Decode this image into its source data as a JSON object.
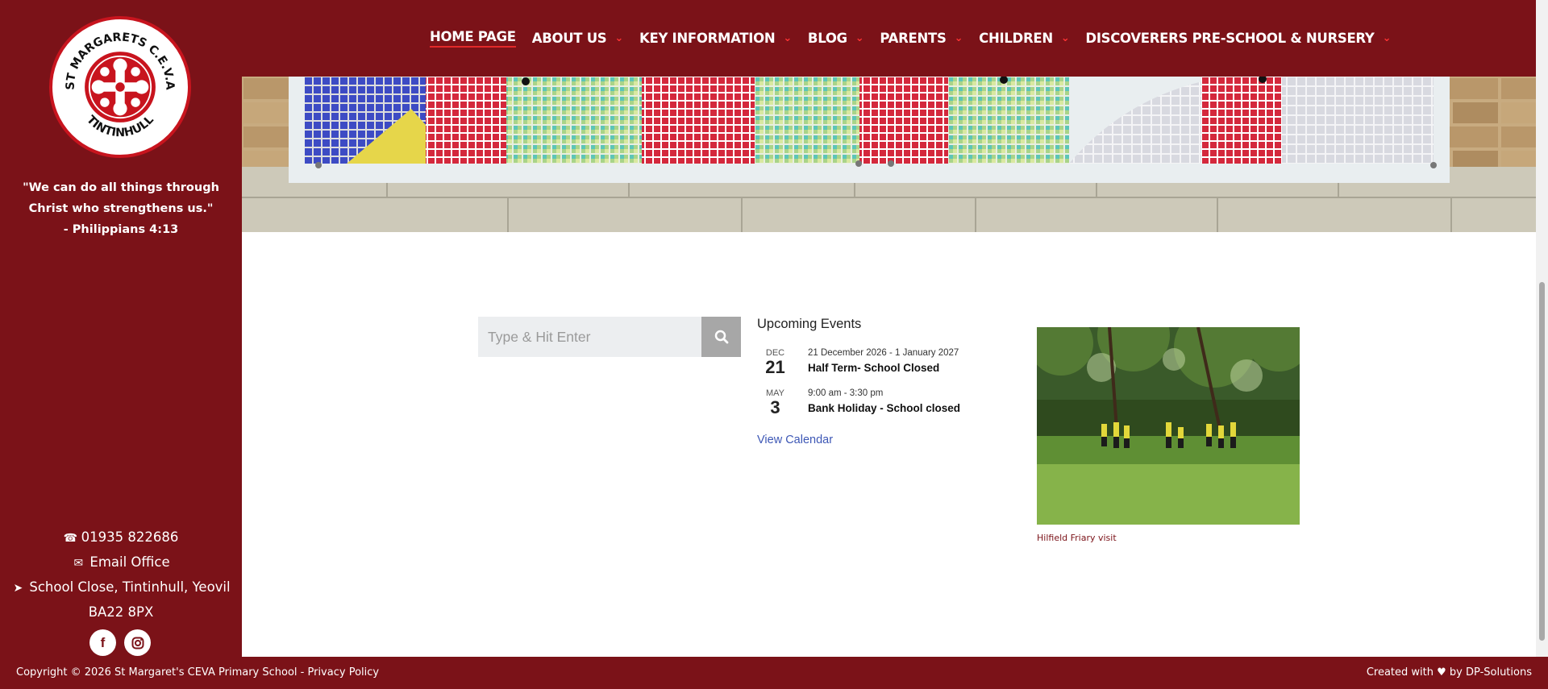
{
  "nav": {
    "items": [
      {
        "label": "HOME PAGE",
        "has_dropdown": false,
        "active": true
      },
      {
        "label": "ABOUT US",
        "has_dropdown": true
      },
      {
        "label": "KEY INFORMATION",
        "has_dropdown": true
      },
      {
        "label": "BLOG",
        "has_dropdown": true
      },
      {
        "label": "PARENTS",
        "has_dropdown": true
      },
      {
        "label": "CHILDREN",
        "has_dropdown": true
      },
      {
        "label": "DISCOVERERS PRE-SCHOOL & NURSERY",
        "has_dropdown": true
      }
    ]
  },
  "sidebar": {
    "logo": {
      "top_text": "ST MARGARETS C.E.V.A",
      "bottom_text": "TINTINHULL"
    },
    "motto_line1": "\"We can do all things through",
    "motto_line2": "Christ who strengthens us.\"",
    "motto_ref": "- Philippians 4:13",
    "phone": "01935 822686",
    "email_label": "Email Office",
    "address_line1": "School Close, Tintinhull, Yeovil",
    "address_line2": "BA22 8PX",
    "social": {
      "facebook": "f",
      "instagram": "instagram-icon"
    }
  },
  "search": {
    "placeholder": "Type & Hit Enter"
  },
  "events": {
    "title": "Upcoming Events",
    "items": [
      {
        "month": "DEC",
        "day": "21",
        "time": "21 December 2026 - 1 January 2027",
        "title": "Half Term- School Closed"
      },
      {
        "month": "MAY",
        "day": "3",
        "time": "9:00 am - 3:30 pm",
        "title": "Bank Holiday - School closed"
      }
    ],
    "view_calendar": "View Calendar"
  },
  "photo": {
    "caption": "Hilfield Friary visit"
  },
  "footer": {
    "left": "Copyright © 2026 St Margaret's CEVA Primary School - Privacy Policy",
    "right_prefix": "Created with",
    "right_suffix": "by DP-Solutions"
  },
  "colors": {
    "brand": "#7b1218",
    "accent": "#e32a2a",
    "link": "#3d57b5"
  }
}
